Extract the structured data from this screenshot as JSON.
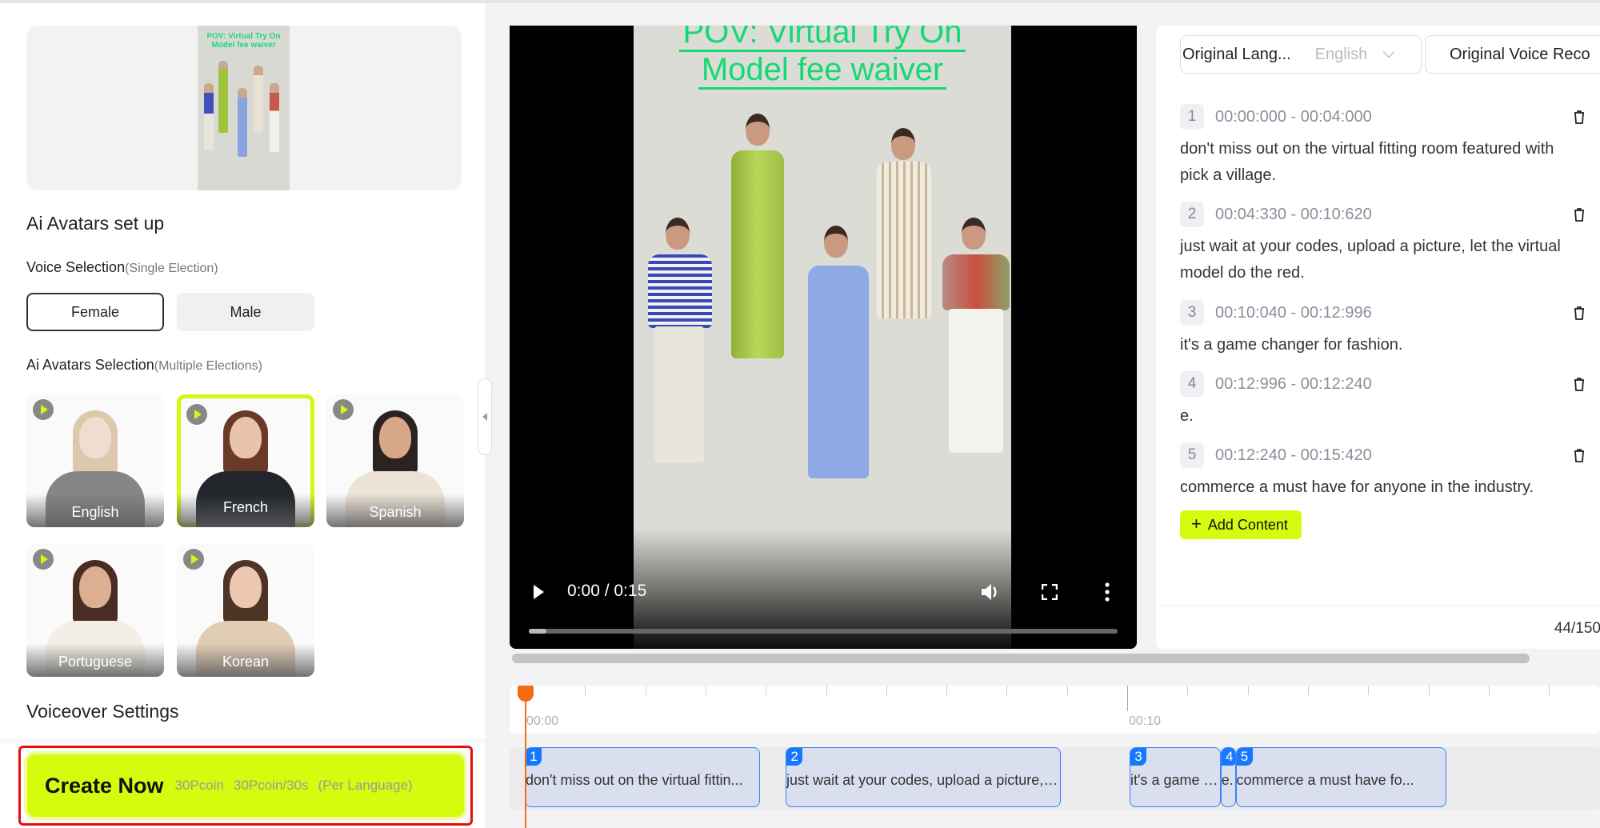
{
  "left_panel": {
    "preview_thumbnail": {
      "title_line1": "POV: Virtual Try On",
      "title_line2": "Model fee waiver"
    },
    "section_title": "Ai Avatars set up",
    "voice_selection": {
      "label": "Voice Selection",
      "hint": "(Single Election)",
      "options": [
        {
          "label": "Female",
          "selected": true
        },
        {
          "label": "Male",
          "selected": false
        }
      ]
    },
    "avatar_selection": {
      "label": "Ai Avatars Selection",
      "hint": "(Multiple Elections)",
      "avatars": [
        {
          "name": "English",
          "selected": false
        },
        {
          "name": "French",
          "selected": true
        },
        {
          "name": "Spanish",
          "selected": false
        },
        {
          "name": "Portuguese",
          "selected": false
        },
        {
          "name": "Korean",
          "selected": false
        }
      ]
    },
    "voiceover_settings_title": "Voiceover Settings",
    "create_button": {
      "label": "Create Now",
      "cost": "30Pcoin",
      "rate": "30Pcoin/30s",
      "note": "(Per Language)"
    }
  },
  "video": {
    "overlay_title_line1": "POV: Virtual Try On",
    "overlay_title_line2": "Model fee waiver",
    "current_time": "0:00",
    "duration": "0:15",
    "time_display": "0:00 / 0:15",
    "progress_fraction": 0.03
  },
  "subtitles": {
    "original_language_label": "Original Lang...",
    "original_language_value": "English",
    "original_voice_label": "Original Voice Reco",
    "segments": [
      {
        "index": "1",
        "time": "00:00:000 - 00:04:000",
        "text": "don't miss out on the virtual fitting room featured with pick a village."
      },
      {
        "index": "2",
        "time": "00:04:330 - 00:10:620",
        "text": "just wait at your codes, upload a picture, let the virtual model do the red."
      },
      {
        "index": "3",
        "time": "00:10:040 - 00:12:996",
        "text": "it's a game changer for fashion."
      },
      {
        "index": "4",
        "time": "00:12:996 - 00:12:240",
        "text": "e."
      },
      {
        "index": "5",
        "time": "00:12:240 - 00:15:420",
        "text": "commerce a must have for anyone in the industry."
      }
    ],
    "add_content_label": "Add Content",
    "char_counter": "44/150"
  },
  "timeline": {
    "labels": [
      {
        "text": "00:00",
        "seconds": 0
      },
      {
        "text": "00:10",
        "seconds": 10
      }
    ],
    "playhead_seconds": 0,
    "clips": [
      {
        "index": "1",
        "text": "don't miss out on the virtual fittin...",
        "start": 0.0,
        "end": 3.9
      },
      {
        "index": "2",
        "text": "just wait at your codes, upload a picture, let ...",
        "start": 4.33,
        "end": 8.9
      },
      {
        "index": "3",
        "text": "it's a game cha...",
        "start": 10.04,
        "end": 11.55
      },
      {
        "index": "4",
        "text": "e.",
        "start": 11.55,
        "end": 11.8
      },
      {
        "index": "5",
        "text": "commerce a must have fo...",
        "start": 11.8,
        "end": 15.3
      }
    ]
  },
  "colors": {
    "accent_lime": "#d6fb0e",
    "playhead_orange": "#f56b0f",
    "clip_blue": "#1677ff",
    "highlight_red": "#e60d0d",
    "overlay_green": "#14d973"
  }
}
